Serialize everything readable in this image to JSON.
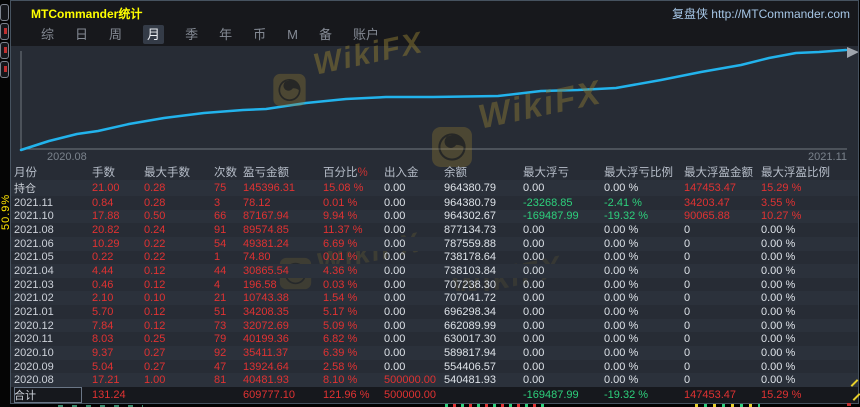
{
  "window": {
    "title": "MTCommander统计",
    "brand": "复盘侠 http://MTCommander.com"
  },
  "menu": {
    "items": [
      {
        "label": "综",
        "active": false
      },
      {
        "label": "日",
        "active": false
      },
      {
        "label": "周",
        "active": false
      },
      {
        "label": "月",
        "active": true
      },
      {
        "label": "季",
        "active": false
      },
      {
        "label": "年",
        "active": false
      },
      {
        "label": "币",
        "active": false
      },
      {
        "label": "M",
        "active": false
      },
      {
        "label": "备",
        "active": false
      },
      {
        "label": "账户",
        "active": false
      }
    ]
  },
  "chart": {
    "x_start": "2020.08",
    "x_end": "2021.11"
  },
  "chart_data": {
    "type": "line",
    "title": "账户余额走势 (balance curve)",
    "x": [
      "2020.08",
      "2020.09",
      "2020.10",
      "2020.11",
      "2020.12",
      "2021.01",
      "2021.02",
      "2021.03",
      "2021.04",
      "2021.05",
      "2021.06",
      "2021.08",
      "2021.10",
      "2021.11"
    ],
    "series": [
      {
        "name": "余额",
        "values": [
          540481.93,
          554406.57,
          589817.94,
          630017.3,
          662089.99,
          696298.34,
          707041.72,
          707238.3,
          738103.84,
          738178.64,
          787559.88,
          877134.73,
          964302.67,
          964380.79
        ]
      }
    ],
    "xlabel": "",
    "ylabel": "",
    "legend": "none",
    "grid": false,
    "line_color": "#22b3ec"
  },
  "watermark": {
    "text": "WikiFX"
  },
  "sliver": {
    "vertical_label": "50.9%"
  },
  "palette": {
    "red": "#e03232",
    "green": "#2dd07c",
    "white": "#dde2e8",
    "title_yellow": "#ffff00",
    "brand_blue": "#a6c6e6",
    "line_cyan": "#22b3ec"
  },
  "table": {
    "headers": [
      "月份",
      "手数",
      "最大手数",
      "次数",
      "盈亏金额",
      "百分比",
      "出入金",
      "余额",
      "最大浮亏",
      "最大浮亏比例",
      "最大浮盈金额",
      "最大浮盈比例"
    ],
    "percent_suffix": "%",
    "rows": [
      {
        "month": "持仓",
        "cells": [
          [
            "21.00",
            "r"
          ],
          [
            "0.28",
            "r"
          ],
          [
            "75",
            "r"
          ],
          [
            "145396.31",
            "r"
          ],
          [
            "15.08 %",
            "r"
          ],
          [
            "0.00",
            "w"
          ],
          [
            "964380.79",
            "w"
          ],
          [
            "0.00",
            "w"
          ],
          [
            "0.00 %",
            "w"
          ],
          [
            "147453.47",
            "r"
          ],
          [
            "15.29 %",
            "r"
          ]
        ]
      },
      {
        "month": "2021.11",
        "cells": [
          [
            "0.84",
            "r"
          ],
          [
            "0.28",
            "r"
          ],
          [
            "3",
            "r"
          ],
          [
            "78.12",
            "r"
          ],
          [
            "0.01 %",
            "r"
          ],
          [
            "0.00",
            "w"
          ],
          [
            "964380.79",
            "w"
          ],
          [
            "-23268.85",
            "g"
          ],
          [
            "-2.41 %",
            "g"
          ],
          [
            "34203.47",
            "r"
          ],
          [
            "3.55 %",
            "r"
          ]
        ]
      },
      {
        "month": "2021.10",
        "cells": [
          [
            "17.88",
            "r"
          ],
          [
            "0.50",
            "r"
          ],
          [
            "66",
            "r"
          ],
          [
            "87167.94",
            "r"
          ],
          [
            "9.94 %",
            "r"
          ],
          [
            "0.00",
            "w"
          ],
          [
            "964302.67",
            "w"
          ],
          [
            "-169487.99",
            "g"
          ],
          [
            "-19.32 %",
            "g"
          ],
          [
            "90065.88",
            "r"
          ],
          [
            "10.27 %",
            "r"
          ]
        ]
      },
      {
        "month": "2021.08",
        "cells": [
          [
            "20.82",
            "r"
          ],
          [
            "0.24",
            "r"
          ],
          [
            "91",
            "r"
          ],
          [
            "89574.85",
            "r"
          ],
          [
            "11.37 %",
            "r"
          ],
          [
            "0.00",
            "w"
          ],
          [
            "877134.73",
            "w"
          ],
          [
            "0.00",
            "w"
          ],
          [
            "0.00 %",
            "w"
          ],
          [
            "0",
            "w"
          ],
          [
            "0.00 %",
            "w"
          ]
        ]
      },
      {
        "month": "2021.06",
        "cells": [
          [
            "10.29",
            "r"
          ],
          [
            "0.22",
            "r"
          ],
          [
            "54",
            "r"
          ],
          [
            "49381.24",
            "r"
          ],
          [
            "6.69 %",
            "r"
          ],
          [
            "0.00",
            "w"
          ],
          [
            "787559.88",
            "w"
          ],
          [
            "0.00",
            "w"
          ],
          [
            "0.00 %",
            "w"
          ],
          [
            "0",
            "w"
          ],
          [
            "0.00 %",
            "w"
          ]
        ]
      },
      {
        "month": "2021.05",
        "cells": [
          [
            "0.22",
            "r"
          ],
          [
            "0.22",
            "r"
          ],
          [
            "1",
            "r"
          ],
          [
            "74.80",
            "r"
          ],
          [
            "0.01 %",
            "r"
          ],
          [
            "0.00",
            "w"
          ],
          [
            "738178.64",
            "w"
          ],
          [
            "0.00",
            "w"
          ],
          [
            "0.00 %",
            "w"
          ],
          [
            "0",
            "w"
          ],
          [
            "0.00 %",
            "w"
          ]
        ]
      },
      {
        "month": "2021.04",
        "cells": [
          [
            "4.44",
            "r"
          ],
          [
            "0.12",
            "r"
          ],
          [
            "44",
            "r"
          ],
          [
            "30865.54",
            "r"
          ],
          [
            "4.36 %",
            "r"
          ],
          [
            "0.00",
            "w"
          ],
          [
            "738103.84",
            "w"
          ],
          [
            "0.00",
            "w"
          ],
          [
            "0.00 %",
            "w"
          ],
          [
            "0",
            "w"
          ],
          [
            "0.00 %",
            "w"
          ]
        ]
      },
      {
        "month": "2021.03",
        "cells": [
          [
            "0.46",
            "r"
          ],
          [
            "0.12",
            "r"
          ],
          [
            "4",
            "r"
          ],
          [
            "196.58",
            "r"
          ],
          [
            "0.03 %",
            "r"
          ],
          [
            "0.00",
            "w"
          ],
          [
            "707238.30",
            "w"
          ],
          [
            "0.00",
            "w"
          ],
          [
            "0.00 %",
            "w"
          ],
          [
            "0",
            "w"
          ],
          [
            "0.00 %",
            "w"
          ]
        ]
      },
      {
        "month": "2021.02",
        "cells": [
          [
            "2.10",
            "r"
          ],
          [
            "0.10",
            "r"
          ],
          [
            "21",
            "r"
          ],
          [
            "10743.38",
            "r"
          ],
          [
            "1.54 %",
            "r"
          ],
          [
            "0.00",
            "w"
          ],
          [
            "707041.72",
            "w"
          ],
          [
            "0.00",
            "w"
          ],
          [
            "0.00 %",
            "w"
          ],
          [
            "0",
            "w"
          ],
          [
            "0.00 %",
            "w"
          ]
        ]
      },
      {
        "month": "2021.01",
        "cells": [
          [
            "5.70",
            "r"
          ],
          [
            "0.12",
            "r"
          ],
          [
            "51",
            "r"
          ],
          [
            "34208.35",
            "r"
          ],
          [
            "5.17 %",
            "r"
          ],
          [
            "0.00",
            "w"
          ],
          [
            "696298.34",
            "w"
          ],
          [
            "0.00",
            "w"
          ],
          [
            "0.00 %",
            "w"
          ],
          [
            "0",
            "w"
          ],
          [
            "0.00 %",
            "w"
          ]
        ]
      },
      {
        "month": "2020.12",
        "cells": [
          [
            "7.84",
            "r"
          ],
          [
            "0.12",
            "r"
          ],
          [
            "73",
            "r"
          ],
          [
            "32072.69",
            "r"
          ],
          [
            "5.09 %",
            "r"
          ],
          [
            "0.00",
            "w"
          ],
          [
            "662089.99",
            "w"
          ],
          [
            "0.00",
            "w"
          ],
          [
            "0.00 %",
            "w"
          ],
          [
            "0",
            "w"
          ],
          [
            "0.00 %",
            "w"
          ]
        ]
      },
      {
        "month": "2020.11",
        "cells": [
          [
            "8.03",
            "r"
          ],
          [
            "0.25",
            "r"
          ],
          [
            "79",
            "r"
          ],
          [
            "40199.36",
            "r"
          ],
          [
            "6.82 %",
            "r"
          ],
          [
            "0.00",
            "w"
          ],
          [
            "630017.30",
            "w"
          ],
          [
            "0.00",
            "w"
          ],
          [
            "0.00 %",
            "w"
          ],
          [
            "0",
            "w"
          ],
          [
            "0.00 %",
            "w"
          ]
        ]
      },
      {
        "month": "2020.10",
        "cells": [
          [
            "9.37",
            "r"
          ],
          [
            "0.27",
            "r"
          ],
          [
            "92",
            "r"
          ],
          [
            "35411.37",
            "r"
          ],
          [
            "6.39 %",
            "r"
          ],
          [
            "0.00",
            "w"
          ],
          [
            "589817.94",
            "w"
          ],
          [
            "0.00",
            "w"
          ],
          [
            "0.00 %",
            "w"
          ],
          [
            "0",
            "w"
          ],
          [
            "0.00 %",
            "w"
          ]
        ]
      },
      {
        "month": "2020.09",
        "cells": [
          [
            "5.04",
            "r"
          ],
          [
            "0.27",
            "r"
          ],
          [
            "47",
            "r"
          ],
          [
            "13924.64",
            "r"
          ],
          [
            "2.58 %",
            "r"
          ],
          [
            "0.00",
            "w"
          ],
          [
            "554406.57",
            "w"
          ],
          [
            "0.00",
            "w"
          ],
          [
            "0.00 %",
            "w"
          ],
          [
            "0",
            "w"
          ],
          [
            "0.00 %",
            "w"
          ]
        ]
      },
      {
        "month": "2020.08",
        "cells": [
          [
            "17.21",
            "r"
          ],
          [
            "1.00",
            "r"
          ],
          [
            "81",
            "r"
          ],
          [
            "40481.93",
            "r"
          ],
          [
            "8.10 %",
            "r"
          ],
          [
            "500000.00",
            "r"
          ],
          [
            "540481.93",
            "w"
          ],
          [
            "0.00",
            "w"
          ],
          [
            "0.00 %",
            "w"
          ],
          [
            "0",
            "w"
          ],
          [
            "0.00 %",
            "w"
          ]
        ]
      },
      {
        "month": "合计",
        "total": true,
        "cells": [
          [
            "131.24",
            "r"
          ],
          [
            "",
            ""
          ],
          [
            "",
            ""
          ],
          [
            "609777.10",
            "r"
          ],
          [
            "121.96 %",
            "r"
          ],
          [
            "500000.00",
            "r"
          ],
          [
            "",
            ""
          ],
          [
            "-169487.99",
            "g"
          ],
          [
            "-19.32 %",
            "g"
          ],
          [
            "147453.47",
            "r"
          ],
          [
            "15.29 %",
            "r"
          ]
        ]
      }
    ]
  }
}
